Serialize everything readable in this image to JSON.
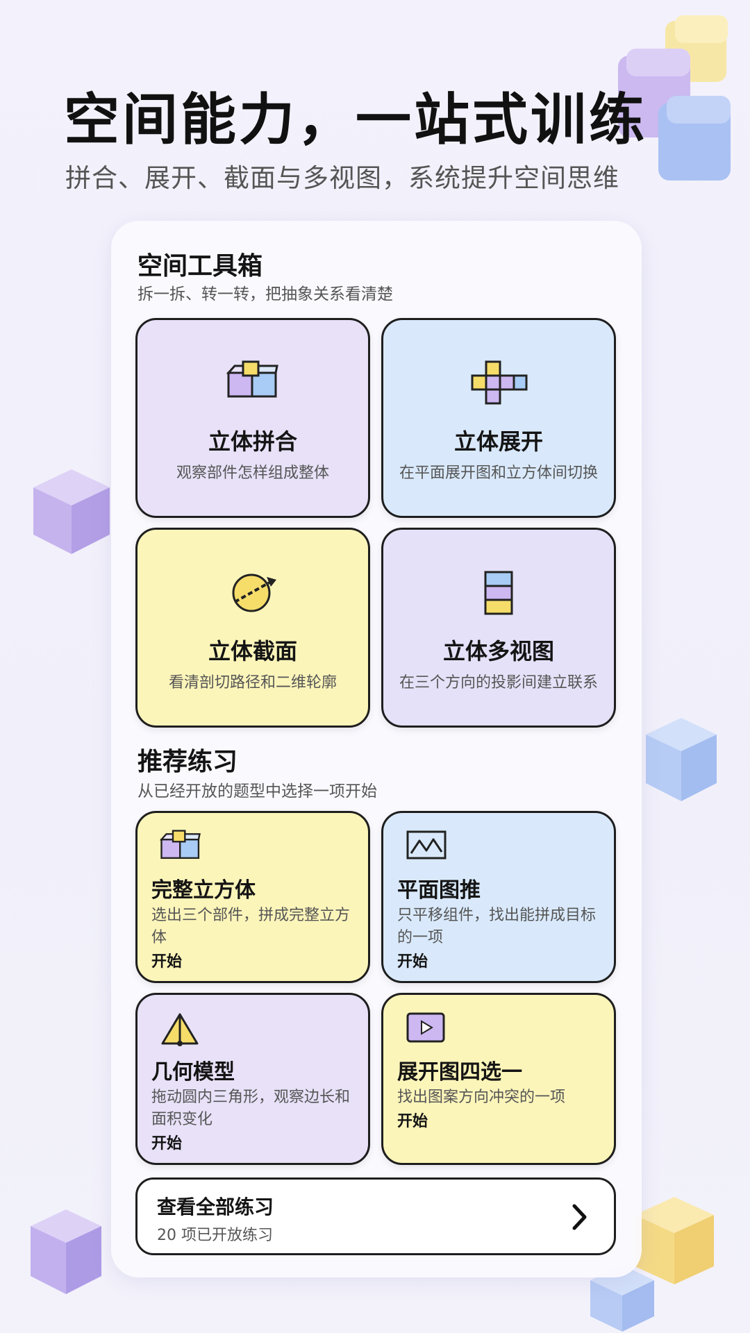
{
  "header": {
    "title": "空间能力，一站式训练",
    "subtitle": "拼合、展开、截面与多视图，系统提升空间思维"
  },
  "toolbox": {
    "title": "空间工具箱",
    "subtitle": "拆一拆、转一转，把抽象关系看清楚",
    "tools": [
      {
        "name": "立体拼合",
        "desc": "观察部件怎样组成整体",
        "icon": "cube-assembly-icon",
        "color": "#e8e1f8"
      },
      {
        "name": "立体展开",
        "desc": "在平面展开图和立方体间切换",
        "icon": "cube-net-icon",
        "color": "#d9e9fb"
      },
      {
        "name": "立体截面",
        "desc": "看清剖切路径和二维轮廓",
        "icon": "cross-section-icon",
        "color": "#fcf5ba"
      },
      {
        "name": "立体多视图",
        "desc": "在三个方向的投影间建立联系",
        "icon": "multi-view-icon",
        "color": "#e5e1f8"
      }
    ]
  },
  "practice": {
    "title": "推荐练习",
    "subtitle": "从已经开放的题型中选择一项开始",
    "items": [
      {
        "name": "完整立方体",
        "desc": "选出三个部件，拼成完整立方体",
        "action": "开始",
        "icon": "cube-assembly-icon",
        "color": "#fcf5ba"
      },
      {
        "name": "平面图推",
        "desc": "只平移组件，找出能拼成目标的一项",
        "action": "开始",
        "icon": "mountain-image-icon",
        "color": "#d9e9fb"
      },
      {
        "name": "几何模型",
        "desc": "拖动圆内三角形，观察边长和面积变化",
        "action": "开始",
        "icon": "triangle-icon",
        "color": "#e8e1f8"
      },
      {
        "name": "展开图四选一",
        "desc": "找出图案方向冲突的一项",
        "action": "开始",
        "icon": "play-icon",
        "color": "#fcf5ba"
      }
    ]
  },
  "view_all": {
    "title": "查看全部练习",
    "subtitle": "20 项已开放练习",
    "icon": "chevron-right-icon"
  }
}
